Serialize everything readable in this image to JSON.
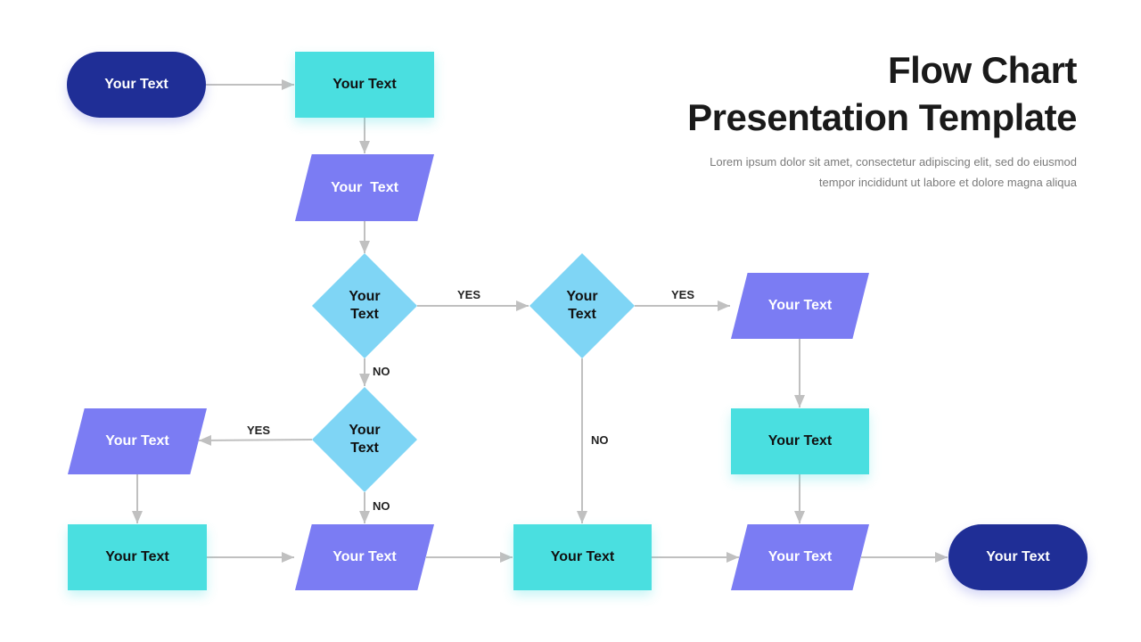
{
  "header": {
    "title_line1": "Flow Chart",
    "title_line2": "Presentation Template",
    "subtitle_line1": "Lorem ipsum dolor sit amet, consectetur adipiscing elit, sed do eiusmod",
    "subtitle_line2": "tempor incididunt ut labore et dolore magna aliqua"
  },
  "colors": {
    "terminal": "#1f2e96",
    "process": "#4adfe0",
    "io": "#7b7cf3",
    "decision": "#7fd5f5",
    "connector": "#c0c0c0"
  },
  "nodes": {
    "start": "Your Text",
    "process_1": "Your Text",
    "io_1": "Your  Text",
    "decision_1_line1": "Your",
    "decision_1_line2": "Text",
    "decision_2_line1": "Your",
    "decision_2_line2": "Text",
    "io_right_top": "Your Text",
    "decision_3_line1": "Your",
    "decision_3_line2": "Text",
    "io_left": "Your Text",
    "process_right": "Your Text",
    "process_bottom_left": "Your Text",
    "io_bottom_mid": "Your Text",
    "process_bottom_center": "Your Text",
    "io_bottom_right": "Your Text",
    "end": "Your Text"
  },
  "edge_labels": {
    "d1_yes": "YES",
    "d1_no": "NO",
    "d2_yes": "YES",
    "d2_no": "NO",
    "d3_yes": "YES",
    "d3_no": "NO"
  }
}
